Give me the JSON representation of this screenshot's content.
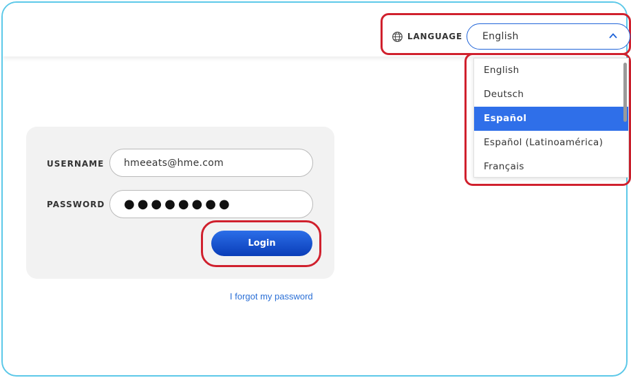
{
  "header": {
    "language_label": "LANGUAGE",
    "language_selected": "English",
    "globe_icon": "globe-icon",
    "chevron_icon": "chevron-up-icon"
  },
  "dropdown": {
    "options": [
      {
        "label": "English",
        "selected": false
      },
      {
        "label": "Deutsch",
        "selected": false
      },
      {
        "label": "Español",
        "selected": true
      },
      {
        "label": "Español (Latinoamérica)",
        "selected": false
      },
      {
        "label": "Français",
        "selected": false
      }
    ]
  },
  "login": {
    "username_label": "USERNAME",
    "username_value": "hmeeats@hme.com",
    "password_label": "PASSWORD",
    "password_value": "●●●●●●●●",
    "login_button": "Login",
    "forgot_link": "I forgot my password"
  },
  "colors": {
    "accent": "#1e63d8",
    "highlight": "#d0202d",
    "frame": "#5bc8e8",
    "selected_option": "#2f6fe9"
  }
}
